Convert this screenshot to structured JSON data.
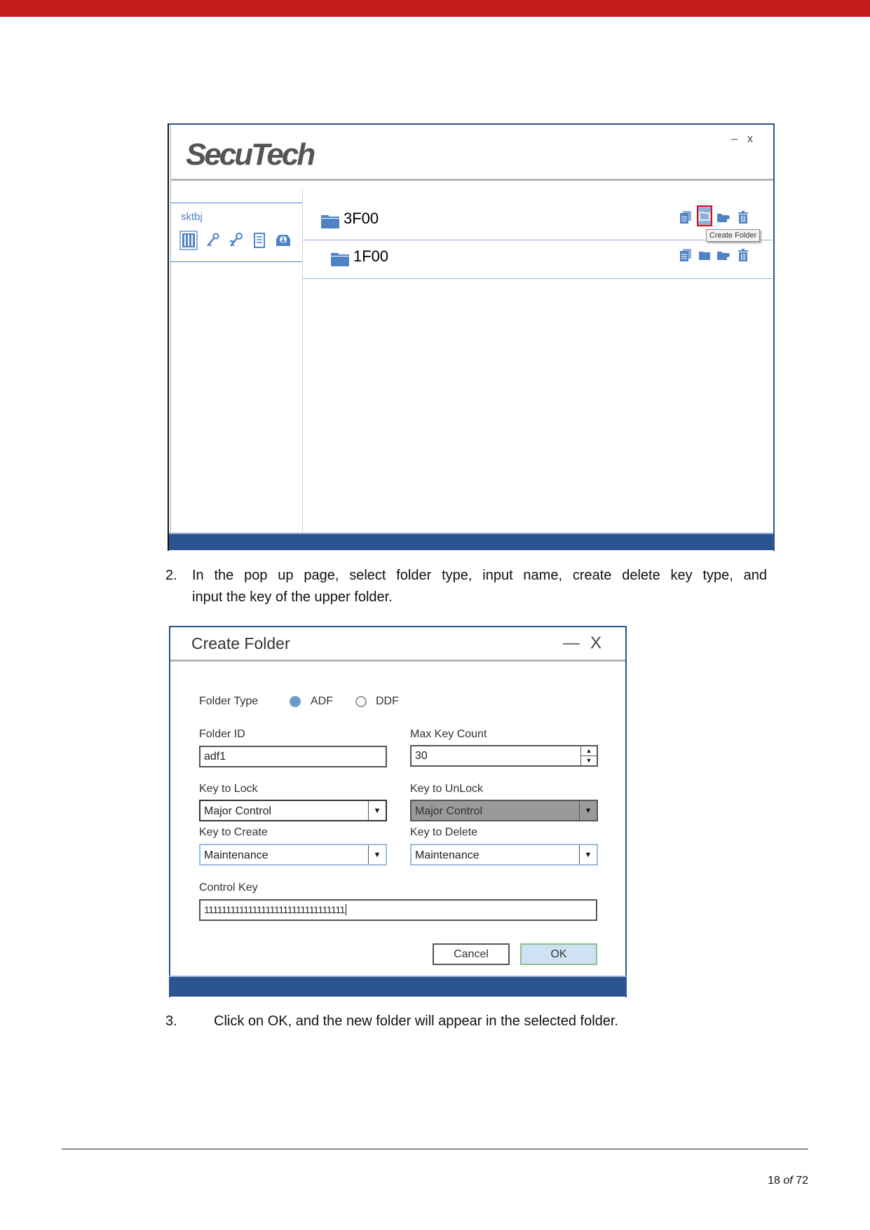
{
  "page": {
    "accent_color": "#c41a1a",
    "step2_number": "2.",
    "step2_text_line1": "In the pop up page, select folder type, input name, create delete key type, and",
    "step2_text_line2": "input the key of the upper folder.",
    "step3_number": "3.",
    "step3_text": "Click on OK, and the new folder will appear in the selected folder.",
    "page_number": "18",
    "page_of": "of",
    "page_total": "72"
  },
  "app_window": {
    "logo": "SecuTech",
    "minimize_glyph": "–",
    "close_glyph": "x",
    "user": "sktbj",
    "sidebar_icons": [
      {
        "name": "key-list-icon",
        "active": true
      },
      {
        "name": "key-icon",
        "active": false
      },
      {
        "name": "keys-icon",
        "active": false
      },
      {
        "name": "document-icon",
        "active": false
      },
      {
        "name": "download-tray-icon",
        "active": false
      }
    ],
    "folders": [
      {
        "name": "3F00",
        "actions": [
          "copy",
          "create-folder",
          "folder-key",
          "delete"
        ],
        "highlighted_action": "create-folder"
      },
      {
        "name": "1F00",
        "actions": [
          "copy",
          "create-folder",
          "folder-key",
          "delete"
        ]
      }
    ],
    "tooltip": "Create Folder",
    "brand_blue": "#2c5491",
    "icon_blue": "#5083c4"
  },
  "dialog": {
    "title": "Create Folder",
    "minimize_glyph": "—",
    "close_glyph": "X",
    "folder_type_label": "Folder Type",
    "folder_type_options": [
      {
        "label": "ADF",
        "selected": true
      },
      {
        "label": "DDF",
        "selected": false
      }
    ],
    "folder_id_label": "Folder ID",
    "folder_id_value": "adf1",
    "max_key_count_label": "Max Key Count",
    "max_key_count_value": "30",
    "key_to_lock_label": "Key to Lock",
    "key_to_lock_value": "Major Control",
    "key_to_unlock_label": "Key to UnLock",
    "key_to_unlock_value": "Major Control",
    "key_to_unlock_disabled": true,
    "key_to_create_label": "Key to Create",
    "key_to_create_value": "Maintenance",
    "key_to_delete_label": "Key to Delete",
    "key_to_delete_value": "Maintenance",
    "control_key_label": "Control Key",
    "control_key_value": "11111111111111111111111111111111",
    "cancel_label": "Cancel",
    "ok_label": "OK"
  }
}
